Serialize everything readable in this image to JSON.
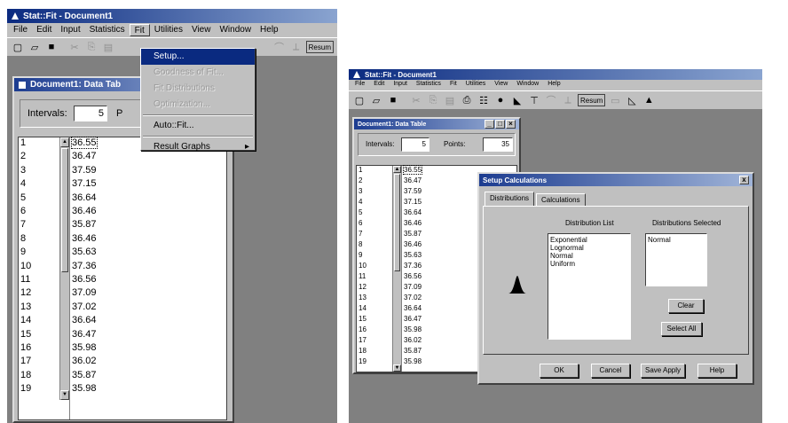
{
  "left": {
    "app_title": "Stat::Fit - Document1",
    "menu": [
      "File",
      "Edit",
      "Input",
      "Statistics",
      "Fit",
      "Utilities",
      "View",
      "Window",
      "Help"
    ],
    "toolbar_box_label": "Resum",
    "doc_title": "Document1: Data Tab",
    "intervals_label": "Intervals:",
    "intervals_value": "5",
    "points_label_partial": "P",
    "fit_menu": {
      "items": [
        {
          "label": "Setup...",
          "state": "selected"
        },
        {
          "label": "Goodness of Fit...",
          "state": "disabled"
        },
        {
          "label": "Fit Distributions",
          "state": "disabled"
        },
        {
          "label": "Optimization...",
          "state": "disabled"
        },
        {
          "label": "Auto::Fit...",
          "state": "normal"
        },
        {
          "label": "Result Graphs",
          "state": "normal",
          "submenu_arrow": "▸"
        }
      ]
    },
    "rows": [
      {
        "n": "1",
        "v": "36.55"
      },
      {
        "n": "2",
        "v": "36.47"
      },
      {
        "n": "3",
        "v": "37.59"
      },
      {
        "n": "4",
        "v": "37.15"
      },
      {
        "n": "5",
        "v": "36.64"
      },
      {
        "n": "6",
        "v": "36.46"
      },
      {
        "n": "7",
        "v": "35.87"
      },
      {
        "n": "8",
        "v": "36.46"
      },
      {
        "n": "9",
        "v": "35.63"
      },
      {
        "n": "10",
        "v": "37.36"
      },
      {
        "n": "11",
        "v": "36.56"
      },
      {
        "n": "12",
        "v": "37.09"
      },
      {
        "n": "13",
        "v": "37.02"
      },
      {
        "n": "14",
        "v": "36.64"
      },
      {
        "n": "15",
        "v": "36.47"
      },
      {
        "n": "16",
        "v": "35.98"
      },
      {
        "n": "17",
        "v": "36.02"
      },
      {
        "n": "18",
        "v": "35.87"
      },
      {
        "n": "19",
        "v": "35.98"
      }
    ]
  },
  "right": {
    "app_title": "Stat::Fit - Document1",
    "menu": [
      "File",
      "Edit",
      "Input",
      "Statistics",
      "Fit",
      "Utilities",
      "View",
      "Window",
      "Help"
    ],
    "toolbar_box_label": "Resum",
    "doc_title": "Document1: Data Table",
    "intervals_label": "Intervals:",
    "intervals_value": "5",
    "points_label": "Points:",
    "points_value": "35",
    "rows": [
      {
        "n": "1",
        "v": "36.55"
      },
      {
        "n": "2",
        "v": "36.47"
      },
      {
        "n": "3",
        "v": "37.59"
      },
      {
        "n": "4",
        "v": "37.15"
      },
      {
        "n": "5",
        "v": "36.64"
      },
      {
        "n": "6",
        "v": "36.46"
      },
      {
        "n": "7",
        "v": "35.87"
      },
      {
        "n": "8",
        "v": "36.46"
      },
      {
        "n": "9",
        "v": "35.63"
      },
      {
        "n": "10",
        "v": "37.36"
      },
      {
        "n": "11",
        "v": "36.56"
      },
      {
        "n": "12",
        "v": "37.09"
      },
      {
        "n": "13",
        "v": "37.02"
      },
      {
        "n": "14",
        "v": "36.64"
      },
      {
        "n": "15",
        "v": "36.47"
      },
      {
        "n": "16",
        "v": "35.98"
      },
      {
        "n": "17",
        "v": "36.02"
      },
      {
        "n": "18",
        "v": "35.87"
      },
      {
        "n": "19",
        "v": "35.98"
      }
    ],
    "dialog": {
      "title": "Setup Calculations",
      "close": "x",
      "tabs": [
        "Distributions",
        "Calculations"
      ],
      "dist_list_label": "Distribution List",
      "dist_selected_label": "Distributions Selected",
      "dist_list": [
        "Exponential",
        "Lognormal",
        "Normal",
        "Uniform"
      ],
      "dist_selected": [
        "Normal"
      ],
      "clear_label": "Clear",
      "select_all_label": "Select All",
      "ok_label": "OK",
      "cancel_label": "Cancel",
      "save_apply_label": "Save Apply",
      "help_label": "Help"
    }
  },
  "colors": {
    "titlebar": "#0a2a80",
    "face": "#c0c0c0",
    "workspace": "#808080"
  }
}
